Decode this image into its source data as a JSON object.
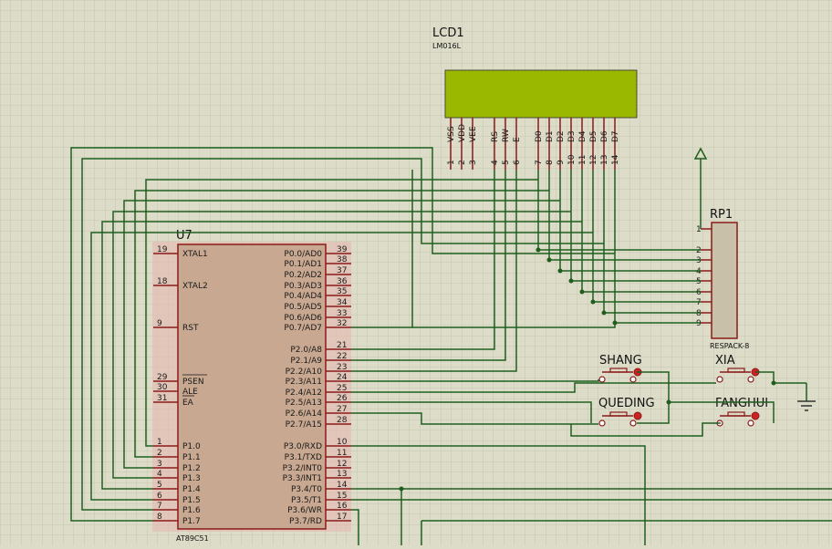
{
  "lcd": {
    "ref": "LCD1",
    "part": "LM016L",
    "screen_color": "#9bb800",
    "pins": [
      {
        "name": "VSS",
        "num": "1"
      },
      {
        "name": "VDD",
        "num": "2"
      },
      {
        "name": "VEE",
        "num": "3"
      },
      {
        "name": "RS",
        "num": "4"
      },
      {
        "name": "RW",
        "num": "5"
      },
      {
        "name": "E",
        "num": "6"
      },
      {
        "name": "D0",
        "num": "7"
      },
      {
        "name": "D1",
        "num": "8"
      },
      {
        "name": "D2",
        "num": "9"
      },
      {
        "name": "D3",
        "num": "10"
      },
      {
        "name": "D4",
        "num": "11"
      },
      {
        "name": "D5",
        "num": "12"
      },
      {
        "name": "D6",
        "num": "13"
      },
      {
        "name": "D7",
        "num": "14"
      }
    ]
  },
  "mcu": {
    "ref": "U7",
    "part": "AT89C51",
    "body_color": "#c8a890",
    "left_pins": [
      {
        "num": "19",
        "name": "XTAL1"
      },
      {
        "num": "18",
        "name": "XTAL2"
      },
      {
        "num": "9",
        "name": "RST"
      },
      {
        "num": "29",
        "name": "PSEN"
      },
      {
        "num": "30",
        "name": "ALE"
      },
      {
        "num": "31",
        "name": "EA"
      },
      {
        "num": "1",
        "name": "P1.0"
      },
      {
        "num": "2",
        "name": "P1.1"
      },
      {
        "num": "3",
        "name": "P1.2"
      },
      {
        "num": "4",
        "name": "P1.3"
      },
      {
        "num": "5",
        "name": "P1.4"
      },
      {
        "num": "6",
        "name": "P1.5"
      },
      {
        "num": "7",
        "name": "P1.6"
      },
      {
        "num": "8",
        "name": "P1.7"
      }
    ],
    "right_pins": [
      {
        "num": "39",
        "name": "P0.0/AD0"
      },
      {
        "num": "38",
        "name": "P0.1/AD1"
      },
      {
        "num": "37",
        "name": "P0.2/AD2"
      },
      {
        "num": "36",
        "name": "P0.3/AD3"
      },
      {
        "num": "35",
        "name": "P0.4/AD4"
      },
      {
        "num": "34",
        "name": "P0.5/AD5"
      },
      {
        "num": "33",
        "name": "P0.6/AD6"
      },
      {
        "num": "32",
        "name": "P0.7/AD7"
      },
      {
        "num": "21",
        "name": "P2.0/A8"
      },
      {
        "num": "22",
        "name": "P2.1/A9"
      },
      {
        "num": "23",
        "name": "P2.2/A10"
      },
      {
        "num": "24",
        "name": "P2.3/A11"
      },
      {
        "num": "25",
        "name": "P2.4/A12"
      },
      {
        "num": "26",
        "name": "P2.5/A13"
      },
      {
        "num": "27",
        "name": "P2.6/A14"
      },
      {
        "num": "28",
        "name": "P2.7/A15"
      },
      {
        "num": "10",
        "name": "P3.0/RXD"
      },
      {
        "num": "11",
        "name": "P3.1/TXD"
      },
      {
        "num": "12",
        "name": "P3.2/INT0"
      },
      {
        "num": "13",
        "name": "P3.3/INT1"
      },
      {
        "num": "14",
        "name": "P3.4/T0"
      },
      {
        "num": "15",
        "name": "P3.5/T1"
      },
      {
        "num": "16",
        "name": "P3.6/WR"
      },
      {
        "num": "17",
        "name": "P3.7/RD"
      }
    ]
  },
  "rp": {
    "ref": "RP1",
    "part": "RESPACK-8",
    "pins": [
      "1",
      "2",
      "3",
      "4",
      "5",
      "6",
      "7",
      "8",
      "9"
    ]
  },
  "buttons": [
    {
      "label": "SHANG"
    },
    {
      "label": "XIA"
    },
    {
      "label": "QUEDING"
    },
    {
      "label": "FANGHUI"
    }
  ],
  "colors": {
    "wire": "#1f5e1f",
    "pin": "#8b1a1a",
    "grid": "#c8c8b4",
    "background": "#dcdcc8"
  }
}
